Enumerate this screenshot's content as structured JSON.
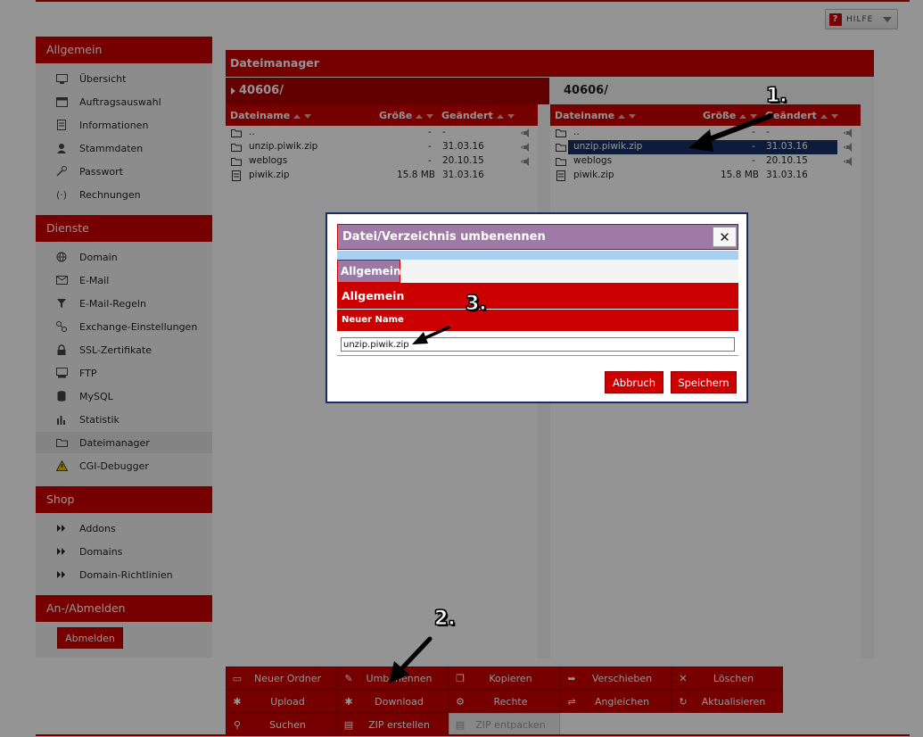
{
  "help": {
    "label": "HILFE"
  },
  "sidebar": {
    "sections": [
      {
        "title": "Allgemein",
        "items": [
          {
            "label": "Übersicht",
            "icon": "monitor-icon"
          },
          {
            "label": "Auftragsauswahl",
            "icon": "window-icon"
          },
          {
            "label": "Informationen",
            "icon": "document-icon"
          },
          {
            "label": "Stammdaten",
            "icon": "user-icon"
          },
          {
            "label": "Passwort",
            "icon": "key-icon"
          },
          {
            "label": "Rechnungen",
            "icon": "invoice-icon"
          }
        ]
      },
      {
        "title": "Dienste",
        "items": [
          {
            "label": "Domain",
            "icon": "globe-icon"
          },
          {
            "label": "E-Mail",
            "icon": "mail-icon"
          },
          {
            "label": "E-Mail-Regeln",
            "icon": "filter-icon"
          },
          {
            "label": "Exchange-Einstellungen",
            "icon": "exchange-icon"
          },
          {
            "label": "SSL-Zertifikate",
            "icon": "lock-icon"
          },
          {
            "label": "FTP",
            "icon": "ftp-icon"
          },
          {
            "label": "MySQL",
            "icon": "database-icon"
          },
          {
            "label": "Statistik",
            "icon": "chart-icon"
          },
          {
            "label": "Dateimanager",
            "icon": "folder-icon"
          },
          {
            "label": "CGI-Debugger",
            "icon": "warning-icon"
          }
        ]
      },
      {
        "title": "Shop",
        "items": [
          {
            "label": "Addons",
            "icon": "double-arrow-icon"
          },
          {
            "label": "Domains",
            "icon": "double-arrow-icon"
          },
          {
            "label": "Domain-Richtlinien",
            "icon": "double-arrow-icon"
          }
        ]
      },
      {
        "title": "An-/Abmelden",
        "items": []
      }
    ],
    "logout_label": "Abmelden"
  },
  "filemanager": {
    "title": "Dateimanager",
    "left_path": "40606/",
    "right_path": "40606/",
    "columns": {
      "name": "Dateiname",
      "size": "Größe",
      "changed": "Geändert"
    },
    "files": [
      {
        "name": "..",
        "size": "-",
        "date": "-",
        "icon": "folder-icon"
      },
      {
        "name": "unzip.piwik.zip",
        "size": "-",
        "date": "31.03.16",
        "icon": "folder-icon"
      },
      {
        "name": "weblogs",
        "size": "-",
        "date": "20.10.15",
        "icon": "folder-icon"
      },
      {
        "name": "piwik.zip",
        "size": "15.8 MB",
        "date": "31.03.16",
        "icon": "file-icon"
      }
    ]
  },
  "actions": [
    {
      "label": "Neuer Ordner",
      "icon": "new-folder-icon"
    },
    {
      "label": "Umbenennen",
      "icon": "rename-icon"
    },
    {
      "label": "Kopieren",
      "icon": "copy-icon"
    },
    {
      "label": "Verschieben",
      "icon": "move-icon"
    },
    {
      "label": "Löschen",
      "icon": "delete-icon"
    },
    {
      "label": "Upload",
      "icon": "upload-icon"
    },
    {
      "label": "Download",
      "icon": "download-icon"
    },
    {
      "label": "Rechte",
      "icon": "permissions-icon"
    },
    {
      "label": "Angleichen",
      "icon": "sync-icon"
    },
    {
      "label": "Aktualisieren",
      "icon": "refresh-icon"
    },
    {
      "label": "Suchen",
      "icon": "search-icon"
    },
    {
      "label": "ZIP erstellen",
      "icon": "zip-icon"
    },
    {
      "label": "ZIP entpacken",
      "icon": "unzip-icon"
    }
  ],
  "dialog": {
    "title": "Datei/Verzeichnis umbenennen",
    "tab": "Allgemein",
    "section": "Allgemein",
    "field_label": "Neuer Name",
    "field_value": "unzip.piwik.zip",
    "cancel": "Abbruch",
    "save": "Speichern"
  },
  "annotations": {
    "one": "1.",
    "two": "2.",
    "three": "3."
  }
}
